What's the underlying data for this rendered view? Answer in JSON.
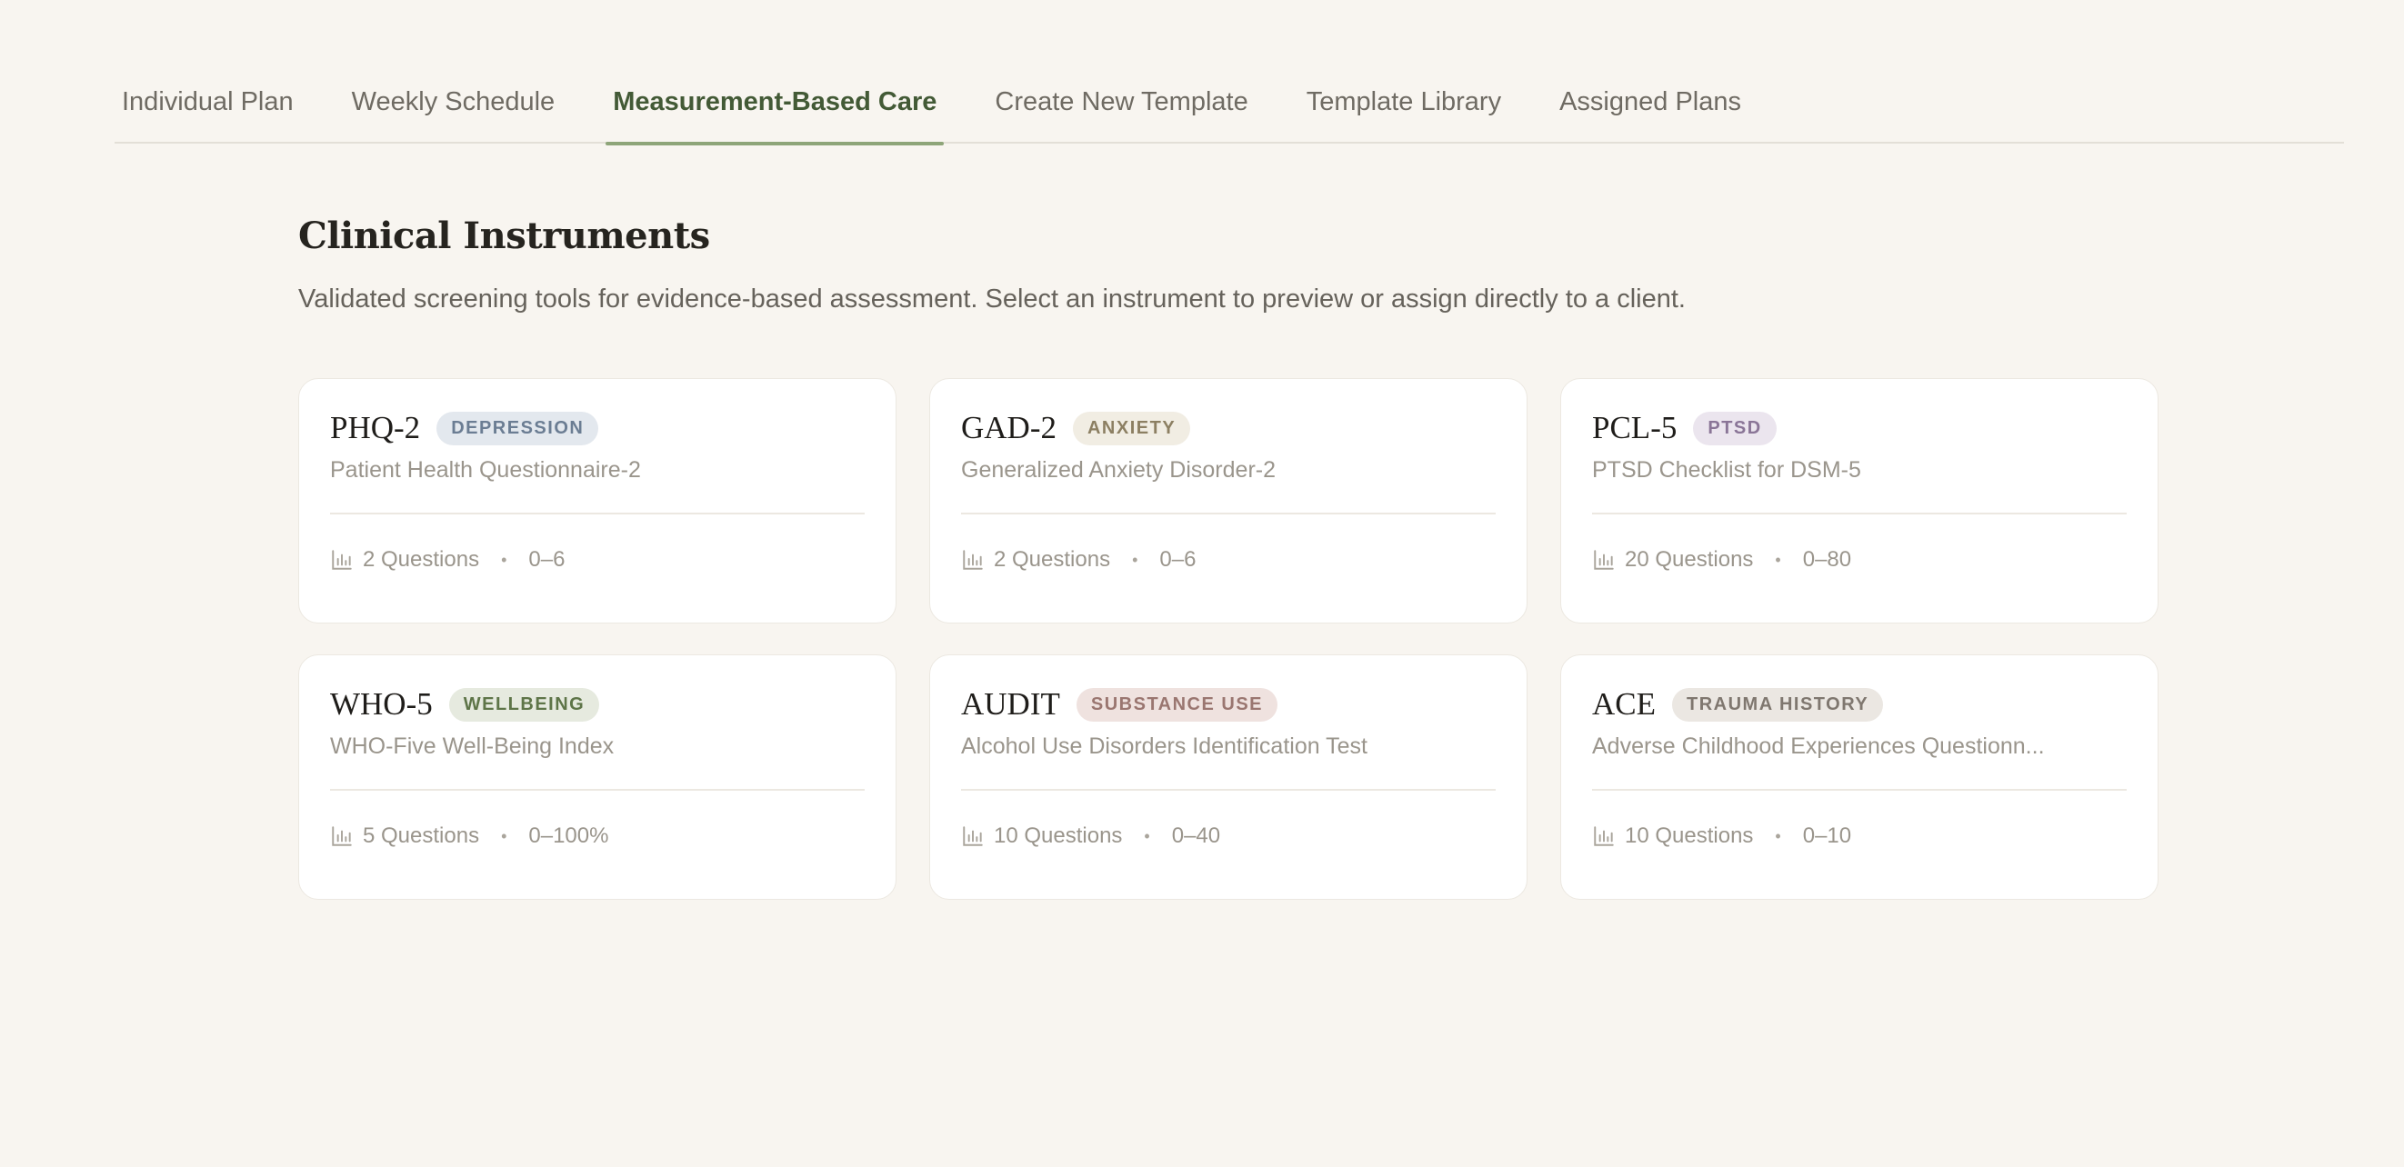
{
  "tabs": [
    {
      "label": "Individual Plan",
      "active": false
    },
    {
      "label": "Weekly Schedule",
      "active": false
    },
    {
      "label": "Measurement-Based Care",
      "active": true
    },
    {
      "label": "Create New Template",
      "active": false
    },
    {
      "label": "Template Library",
      "active": false
    },
    {
      "label": "Assigned Plans",
      "active": false
    }
  ],
  "header": {
    "title": "Clinical Instruments",
    "subtitle": "Validated screening tools for evidence-based assessment. Select an instrument to preview or assign directly to a client."
  },
  "instruments": [
    {
      "abbr": "PHQ-2",
      "category": "DEPRESSION",
      "badge_bg": "#e3e8ee",
      "badge_fg": "#6b7d93",
      "full_name": "Patient Health Questionnaire-2",
      "questions": "2 Questions",
      "range": "0–6"
    },
    {
      "abbr": "GAD-2",
      "category": "ANXIETY",
      "badge_bg": "#f1ede3",
      "badge_fg": "#8c7f62",
      "full_name": "Generalized Anxiety Disorder-2",
      "questions": "2 Questions",
      "range": "0–6"
    },
    {
      "abbr": "PCL-5",
      "category": "PTSD",
      "badge_bg": "#ebe5ee",
      "badge_fg": "#8a7597",
      "full_name": "PTSD Checklist for DSM-5",
      "questions": "20 Questions",
      "range": "0–80"
    },
    {
      "abbr": "WHO-5",
      "category": "WELLBEING",
      "badge_bg": "#e6eadf",
      "badge_fg": "#5e7548",
      "full_name": "WHO-Five Well-Being Index",
      "questions": "5 Questions",
      "range": "0–100%"
    },
    {
      "abbr": "AUDIT",
      "category": "SUBSTANCE USE",
      "badge_bg": "#efe2df",
      "badge_fg": "#9a7670",
      "full_name": "Alcohol Use Disorders Identification Test",
      "questions": "10 Questions",
      "range": "0–40"
    },
    {
      "abbr": "ACE",
      "category": "TRAUMA HISTORY",
      "badge_bg": "#ebe7e2",
      "badge_fg": "#7f776f",
      "full_name": "Adverse Childhood Experiences Questionn...",
      "questions": "10 Questions",
      "range": "0–10"
    }
  ],
  "meta": {
    "separator": "•",
    "icon": "bar-chart-icon"
  }
}
